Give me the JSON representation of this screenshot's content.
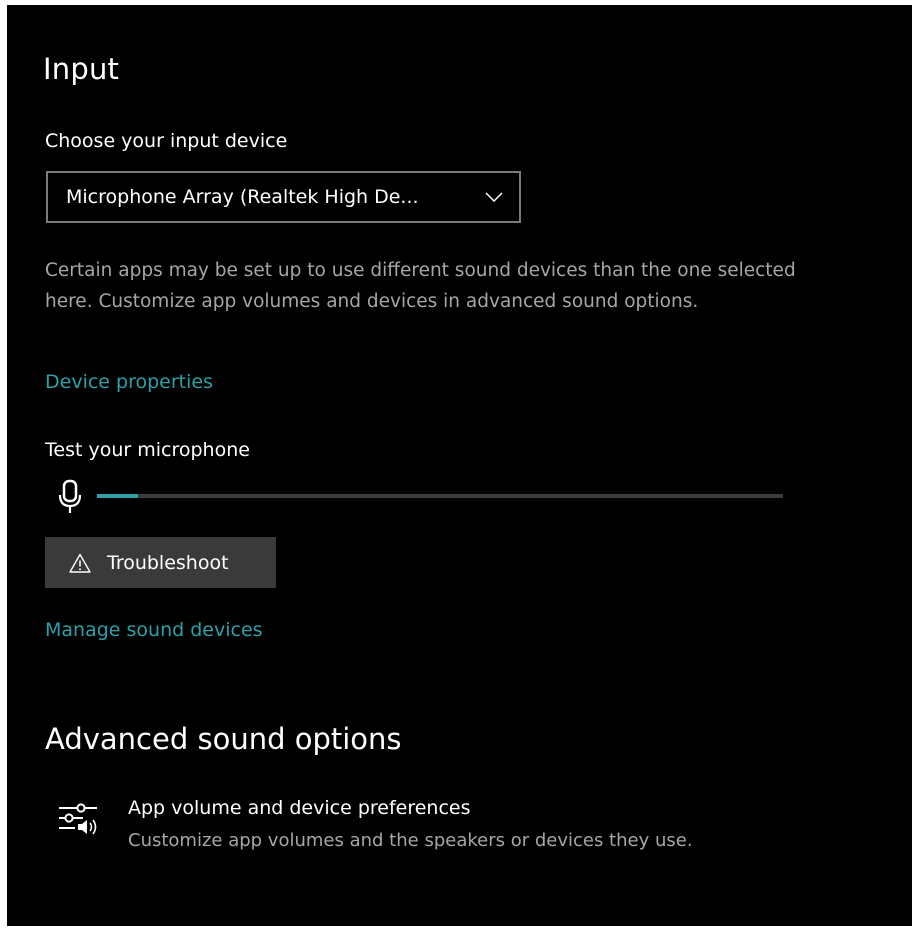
{
  "input": {
    "title": "Input",
    "choose_label": "Choose your input device",
    "device_select": {
      "value": "Microphone Array (Realtek High De..."
    },
    "help_text": "Certain apps may be set up to use different sound devices than the one selected here. Customize app volumes and devices in advanced sound options.",
    "device_properties_link": "Device properties",
    "test_label": "Test your microphone",
    "mic_level_percent": 6,
    "troubleshoot_label": "Troubleshoot",
    "manage_devices_link": "Manage sound devices"
  },
  "advanced": {
    "title": "Advanced sound options",
    "app_volume": {
      "title": "App volume and device preferences",
      "description": "Customize app volumes and the speakers or devices they use."
    }
  },
  "colors": {
    "background": "#000000",
    "accent": "#2ca0a8",
    "secondary_text": "#a6a6a6",
    "button_bg": "#3a3a3a"
  },
  "icons": {
    "dropdown": "chevron-down-icon",
    "mic": "microphone-icon",
    "warning": "warning-icon",
    "app_volume": "equalizer-speaker-icon"
  }
}
